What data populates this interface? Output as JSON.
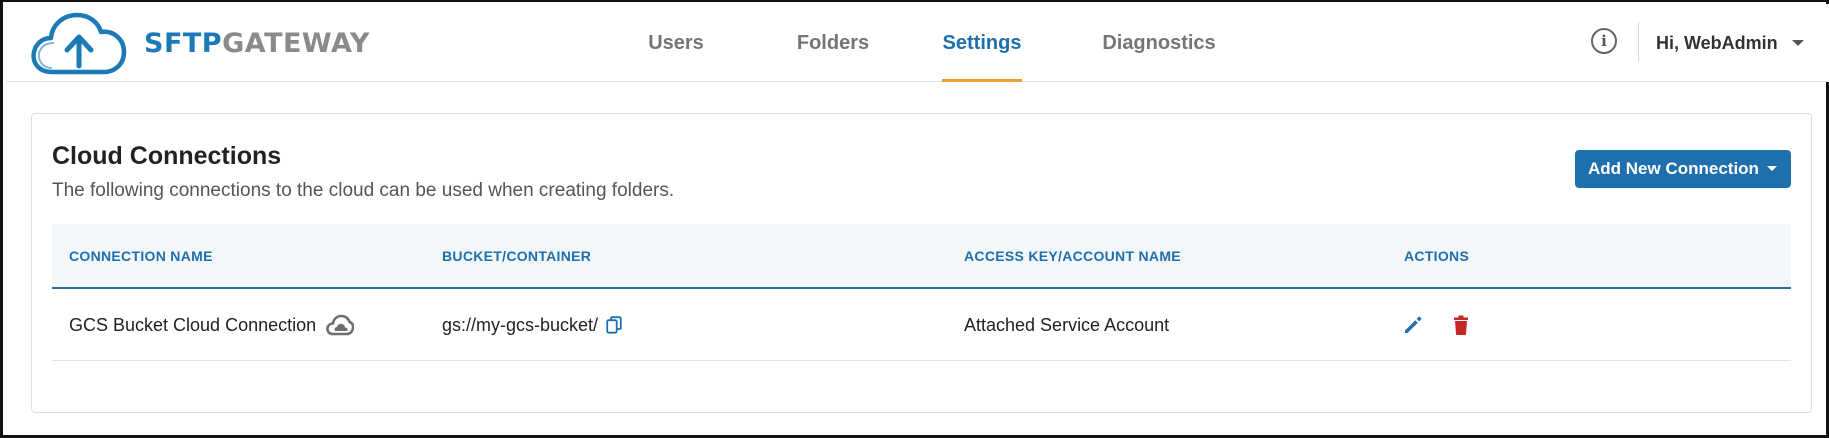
{
  "brand": {
    "part1": "SFTP",
    "part2": "GATEWAY"
  },
  "nav": {
    "items": [
      {
        "label": "Users"
      },
      {
        "label": "Folders"
      },
      {
        "label": "Settings"
      },
      {
        "label": "Diagnostics"
      }
    ],
    "active": "Settings"
  },
  "header": {
    "user_greeting": "Hi, WebAdmin"
  },
  "card": {
    "title": "Cloud Connections",
    "subtitle": "The following connections to the cloud can be used when creating folders.",
    "add_button_label": "Add New Connection"
  },
  "table": {
    "columns": [
      "CONNECTION NAME",
      "BUCKET/CONTAINER",
      "ACCESS KEY/ACCOUNT NAME",
      "ACTIONS"
    ],
    "rows": [
      {
        "name": "GCS Bucket Cloud Connection",
        "bucket": "gs://my-gcs-bucket/",
        "account": "Attached Service Account"
      }
    ]
  },
  "colors": {
    "primary": "#1e6fad",
    "accent_underline": "#f0a030",
    "delete": "#c62828",
    "brand_blue": "#1b7ab5",
    "brand_gray": "#8a8a8a"
  },
  "icons": [
    "cloud-upload-logo-icon",
    "info-icon",
    "chevron-down-icon",
    "cloud-icon",
    "copy-icon",
    "edit-pencil-icon",
    "delete-trash-icon"
  ]
}
